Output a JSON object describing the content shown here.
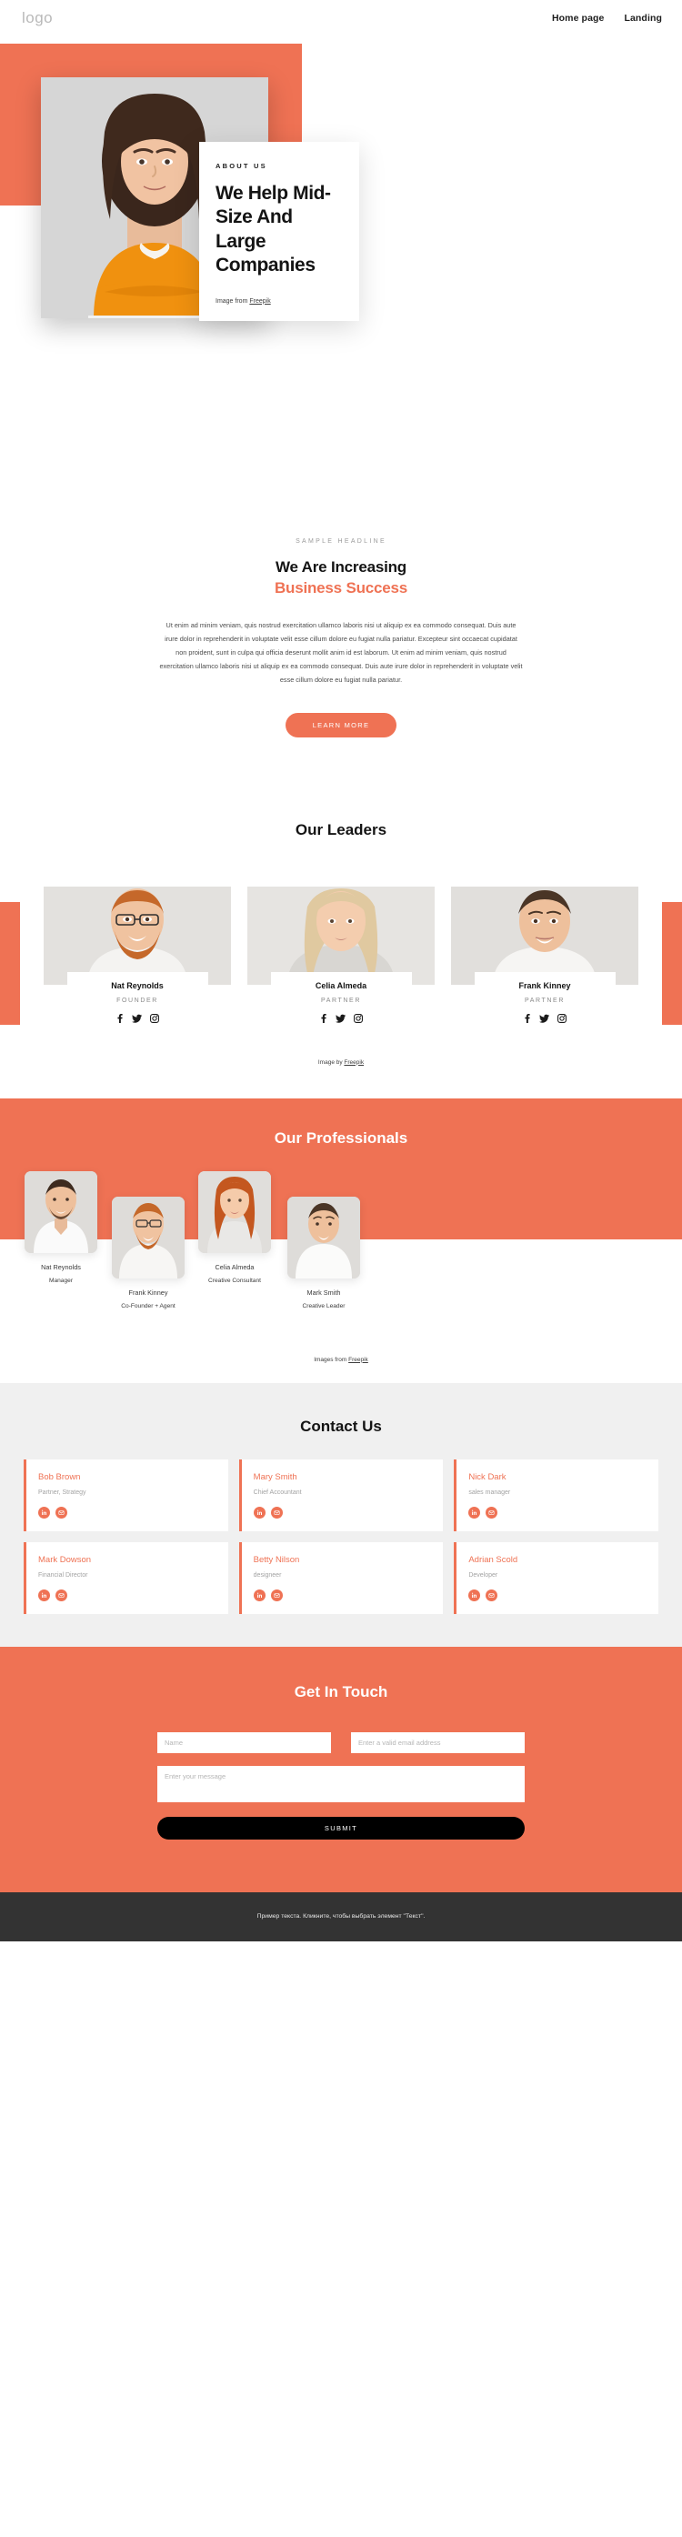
{
  "header": {
    "logo": "logo",
    "nav": [
      {
        "label": "Home page"
      },
      {
        "label": "Landing"
      }
    ]
  },
  "hero": {
    "eyebrow": "ABOUT US",
    "title": "We Help Mid-Size And Large Companies",
    "credit_prefix": "Image from ",
    "credit_link": "Freepik"
  },
  "sample": {
    "eyebrow": "SAMPLE HEADLINE",
    "title_line1": "We Are Increasing",
    "title_line2": "Business Success",
    "body": "Ut enim ad minim veniam, quis nostrud exercitation ullamco laboris nisi ut aliquip ex ea commodo consequat. Duis aute irure dolor in reprehenderit in voluptate velit esse cillum dolore eu fugiat nulla pariatur. Excepteur sint occaecat cupidatat non proident, sunt in culpa qui officia deserunt mollit anim id est laborum. Ut enim ad minim veniam, quis nostrud exercitation ullamco laboris nisi ut aliquip ex ea commodo consequat. Duis aute irure dolor in reprehenderit in voluptate velit esse cillum dolore eu fugiat nulla pariatur.",
    "button": "LEARN MORE"
  },
  "leaders": {
    "title": "Our Leaders",
    "credit_prefix": "Image by ",
    "credit_link": "Freepik",
    "items": [
      {
        "name": "Nat Reynolds",
        "role": "FOUNDER"
      },
      {
        "name": "Celia Almeda",
        "role": "PARTNER"
      },
      {
        "name": "Frank Kinney",
        "role": "PARTNER"
      }
    ]
  },
  "professionals": {
    "title": "Our Professionals",
    "credit_prefix": "Images from ",
    "credit_link": "Freepik",
    "items": [
      {
        "name": "Nat Reynolds",
        "role": "Manager"
      },
      {
        "name": "Frank Kinney",
        "role": "Co-Founder + Agent"
      },
      {
        "name": "Celia Almeda",
        "role": "Creative Consultant"
      },
      {
        "name": "Mark Smith",
        "role": "Creative Leader"
      }
    ]
  },
  "contact": {
    "title": "Contact Us",
    "items": [
      {
        "name": "Bob Brown",
        "role": "Partner, Strategy"
      },
      {
        "name": "Mary Smith",
        "role": "Chief Accountant"
      },
      {
        "name": "Nick Dark",
        "role": "sales manager"
      },
      {
        "name": "Mark Dowson",
        "role": "Financial Director"
      },
      {
        "name": "Betty Nilson",
        "role": "designeer"
      },
      {
        "name": "Adrian Scold",
        "role": "Developer"
      }
    ]
  },
  "touch": {
    "title": "Get In Touch",
    "name_placeholder": "Name",
    "email_placeholder": "Enter a valid email address",
    "message_placeholder": "Enter your message",
    "submit": "SUBMIT"
  },
  "footer": {
    "text": "Пример текста. Кликните, чтобы выбрать элемент \"Текст\"."
  },
  "colors": {
    "accent": "#ef7254",
    "dark": "#333333",
    "ink": "#141414"
  }
}
